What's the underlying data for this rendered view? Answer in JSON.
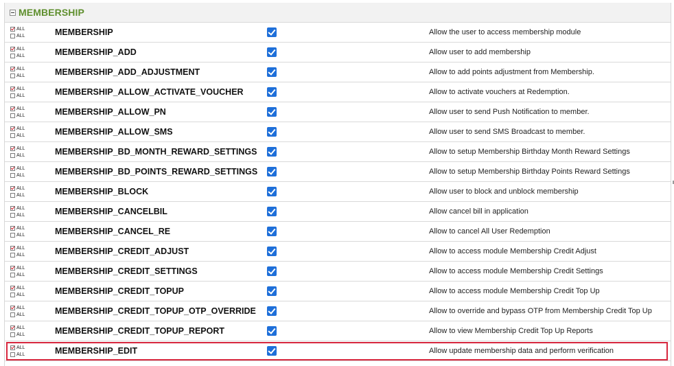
{
  "section": {
    "title": "MEMBERSHIP",
    "collapsed": false
  },
  "all_labels": {
    "top": "ALL",
    "bottom": "ALL"
  },
  "rows": [
    {
      "code": "MEMBERSHIP",
      "checked": true,
      "description": "Allow the user to access membership module"
    },
    {
      "code": "MEMBERSHIP_ADD",
      "checked": true,
      "description": "Allow user to add membership"
    },
    {
      "code": "MEMBERSHIP_ADD_ADJUSTMENT",
      "checked": true,
      "description": "Allow to add points adjustment from Membership."
    },
    {
      "code": "MEMBERSHIP_ALLOW_ACTIVATE_VOUCHER",
      "checked": true,
      "description": "Allow to activate vouchers at Redemption."
    },
    {
      "code": "MEMBERSHIP_ALLOW_PN",
      "checked": true,
      "description": "Allow user to send Push Notification to member."
    },
    {
      "code": "MEMBERSHIP_ALLOW_SMS",
      "checked": true,
      "description": "Allow user to send SMS Broadcast to member."
    },
    {
      "code": "MEMBERSHIP_BD_MONTH_REWARD_SETTINGS",
      "checked": true,
      "description": "Allow to setup Membership Birthday Month Reward Settings"
    },
    {
      "code": "MEMBERSHIP_BD_POINTS_REWARD_SETTINGS",
      "checked": true,
      "description": "Allow to setup Membership Birthday Points Reward Settings"
    },
    {
      "code": "MEMBERSHIP_BLOCK",
      "checked": true,
      "description": "Allow user to block and unblock membership"
    },
    {
      "code": "MEMBERSHIP_CANCELBIL",
      "checked": true,
      "description": "Allow cancel bill in application"
    },
    {
      "code": "MEMBERSHIP_CANCEL_RE",
      "checked": true,
      "description": "Allow to cancel All User Redemption"
    },
    {
      "code": "MEMBERSHIP_CREDIT_ADJUST",
      "checked": true,
      "description": "Allow to access module Membership Credit Adjust"
    },
    {
      "code": "MEMBERSHIP_CREDIT_SETTINGS",
      "checked": true,
      "description": "Allow to access module Membership Credit Settings"
    },
    {
      "code": "MEMBERSHIP_CREDIT_TOPUP",
      "checked": true,
      "description": "Allow to access module Membership Credit Top Up"
    },
    {
      "code": "MEMBERSHIP_CREDIT_TOPUP_OTP_OVERRIDE",
      "checked": true,
      "description": "Allow to override and bypass OTP from Membership Credit Top Up"
    },
    {
      "code": "MEMBERSHIP_CREDIT_TOPUP_REPORT",
      "checked": true,
      "description": "Allow to view Membership Credit Top Up Reports"
    },
    {
      "code": "MEMBERSHIP_EDIT",
      "checked": true,
      "description": "Allow update membership data and perform verification",
      "highlighted": true
    }
  ],
  "colors": {
    "section_title": "#5f8f2e",
    "checkbox_blue": "#1e6fd9",
    "highlight_red": "#d7263d",
    "mini_check_red": "#d0212e"
  }
}
